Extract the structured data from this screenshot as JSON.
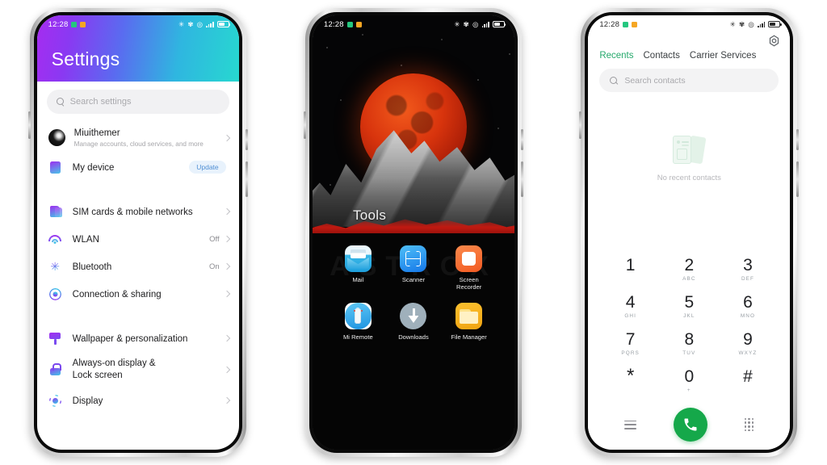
{
  "status_bar": {
    "time": "12:28",
    "icons": [
      "bluetooth-icon",
      "do-not-disturb-icon",
      "alarm-icon",
      "signal-icon",
      "battery-icon"
    ]
  },
  "phone1_settings": {
    "title": "Settings",
    "search": {
      "placeholder": "Search settings"
    },
    "account": {
      "name": "Miuithemer",
      "subtitle": "Manage accounts, cloud services, and more"
    },
    "device": {
      "label": "My device",
      "badge": "Update"
    },
    "items": [
      {
        "label": "SIM cards & mobile networks",
        "value": ""
      },
      {
        "label": "WLAN",
        "value": "Off"
      },
      {
        "label": "Bluetooth",
        "value": "On"
      },
      {
        "label": "Connection & sharing",
        "value": ""
      }
    ],
    "items2": [
      {
        "label": "Wallpaper & personalization",
        "value": ""
      },
      {
        "label": "Always-on display & Lock screen",
        "value": ""
      },
      {
        "label": "Display",
        "value": ""
      }
    ]
  },
  "phone2_home": {
    "folder_title": "Tools",
    "watermark": "ASTROX",
    "apps": [
      {
        "name": "Mail"
      },
      {
        "name": "Scanner"
      },
      {
        "name": "Screen Recorder"
      },
      {
        "name": "Mi Remote"
      },
      {
        "name": "Downloads"
      },
      {
        "name": "File Manager"
      }
    ]
  },
  "phone3_dialer": {
    "tabs": [
      {
        "label": "Recents",
        "active": true
      },
      {
        "label": "Contacts",
        "active": false
      },
      {
        "label": "Carrier Services",
        "active": false
      }
    ],
    "search": {
      "placeholder": "Search contacts"
    },
    "empty_text": "No recent contacts",
    "keys": [
      {
        "num": "1",
        "sub": ""
      },
      {
        "num": "2",
        "sub": "ABC"
      },
      {
        "num": "3",
        "sub": "DEF"
      },
      {
        "num": "4",
        "sub": "GHI"
      },
      {
        "num": "5",
        "sub": "JKL"
      },
      {
        "num": "6",
        "sub": "MNO"
      },
      {
        "num": "7",
        "sub": "PQRS"
      },
      {
        "num": "8",
        "sub": "TUV"
      },
      {
        "num": "9",
        "sub": "WXYZ"
      },
      {
        "num": "*",
        "sub": ""
      },
      {
        "num": "0",
        "sub": "+"
      },
      {
        "num": "#",
        "sub": ""
      }
    ]
  },
  "colors": {
    "accent_green": "#15a84a",
    "tab_active": "#26a96c",
    "gradient_start": "#a82bf0",
    "gradient_end": "#27d8d0",
    "badge_text": "#4f8fd4",
    "moon_red": "#d8340d"
  }
}
